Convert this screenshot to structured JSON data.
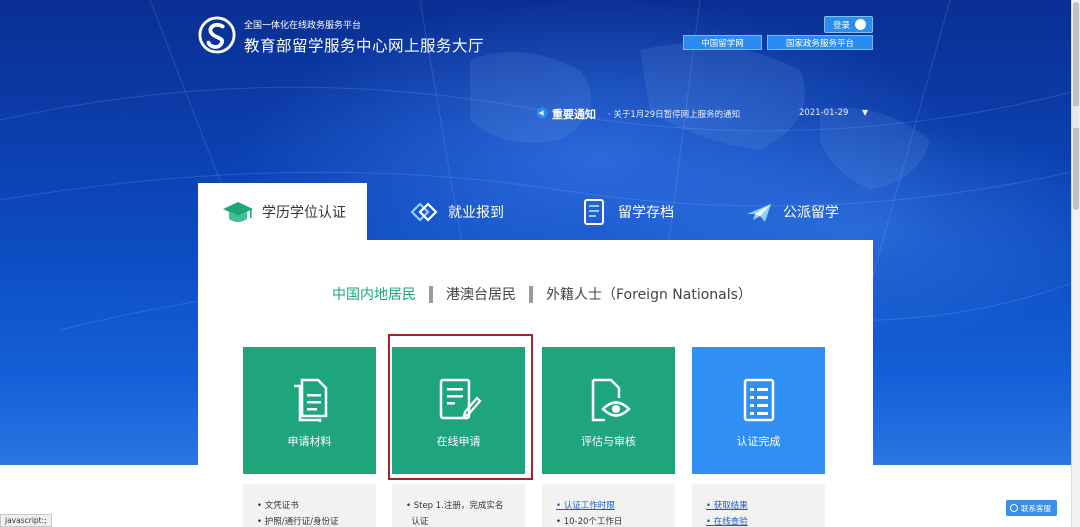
{
  "header": {
    "site_subtitle": "全国一体化在线政务服务平台",
    "site_title": "教育部留学服务中心网上服务大厅",
    "login_label": "登录",
    "links": [
      "中国留学网",
      "国家政务服务平台"
    ]
  },
  "notice": {
    "label": "重要通知",
    "text": "· 关于1月29日暂停网上服务的通知",
    "date": "2021-01-29",
    "arrow": "▼"
  },
  "tabs": [
    {
      "label": "学历学位认证",
      "icon": "graduation-cap-icon",
      "active": true
    },
    {
      "label": "就业报到",
      "icon": "employment-icon",
      "active": false
    },
    {
      "label": "留学存档",
      "icon": "archive-icon",
      "active": false
    },
    {
      "label": "公派留学",
      "icon": "airplane-icon",
      "active": false
    }
  ],
  "categories": [
    {
      "label": "中国内地居民",
      "active": true
    },
    {
      "label": "港澳台居民",
      "active": false
    },
    {
      "label": "外籍人士（Foreign Nationals）",
      "active": false
    }
  ],
  "steps": [
    {
      "label": "申请材料",
      "icon": "documents-icon",
      "color": "#1fa57b"
    },
    {
      "label": "在线申请",
      "icon": "form-edit-icon",
      "color": "#1fa57b",
      "highlighted": true
    },
    {
      "label": "评估与审核",
      "icon": "document-review-icon",
      "color": "#1fa57b"
    },
    {
      "label": "认证完成",
      "icon": "checklist-icon",
      "color": "#2f8ff2"
    }
  ],
  "step_info": [
    {
      "lines": [
        "• 文凭证书",
        "• 护照/通行证/身份证"
      ]
    },
    {
      "lines": [
        "• Step 1.注册，完成实名",
        "  认证"
      ]
    },
    {
      "lines": [
        "• 认证工作时限",
        "• 10-20个工作日"
      ]
    },
    {
      "lines": [
        "• 获取结果",
        "• 在线查验"
      ]
    }
  ],
  "status_bar": "javascript:;",
  "service_label": "联系客服",
  "colors": {
    "green": "#1fa57b",
    "blue": "#2f8ff2",
    "highlight": "#a3252a",
    "background": "#0b3fa6"
  }
}
